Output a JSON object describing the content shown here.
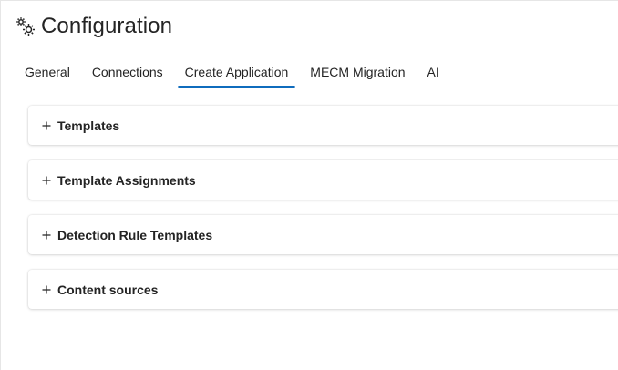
{
  "header": {
    "icon": "gears-icon",
    "title": "Configuration"
  },
  "tabs": [
    {
      "label": "General",
      "active": false
    },
    {
      "label": "Connections",
      "active": false
    },
    {
      "label": "Create Application",
      "active": true
    },
    {
      "label": "MECM Migration",
      "active": false
    },
    {
      "label": "AI",
      "active": false
    }
  ],
  "accent_color": "#0f6cbd",
  "sections": [
    {
      "label": "Templates",
      "icon": "plus-icon"
    },
    {
      "label": "Template Assignments",
      "icon": "plus-icon"
    },
    {
      "label": "Detection Rule Templates",
      "icon": "plus-icon"
    },
    {
      "label": "Content sources",
      "icon": "plus-icon"
    }
  ]
}
